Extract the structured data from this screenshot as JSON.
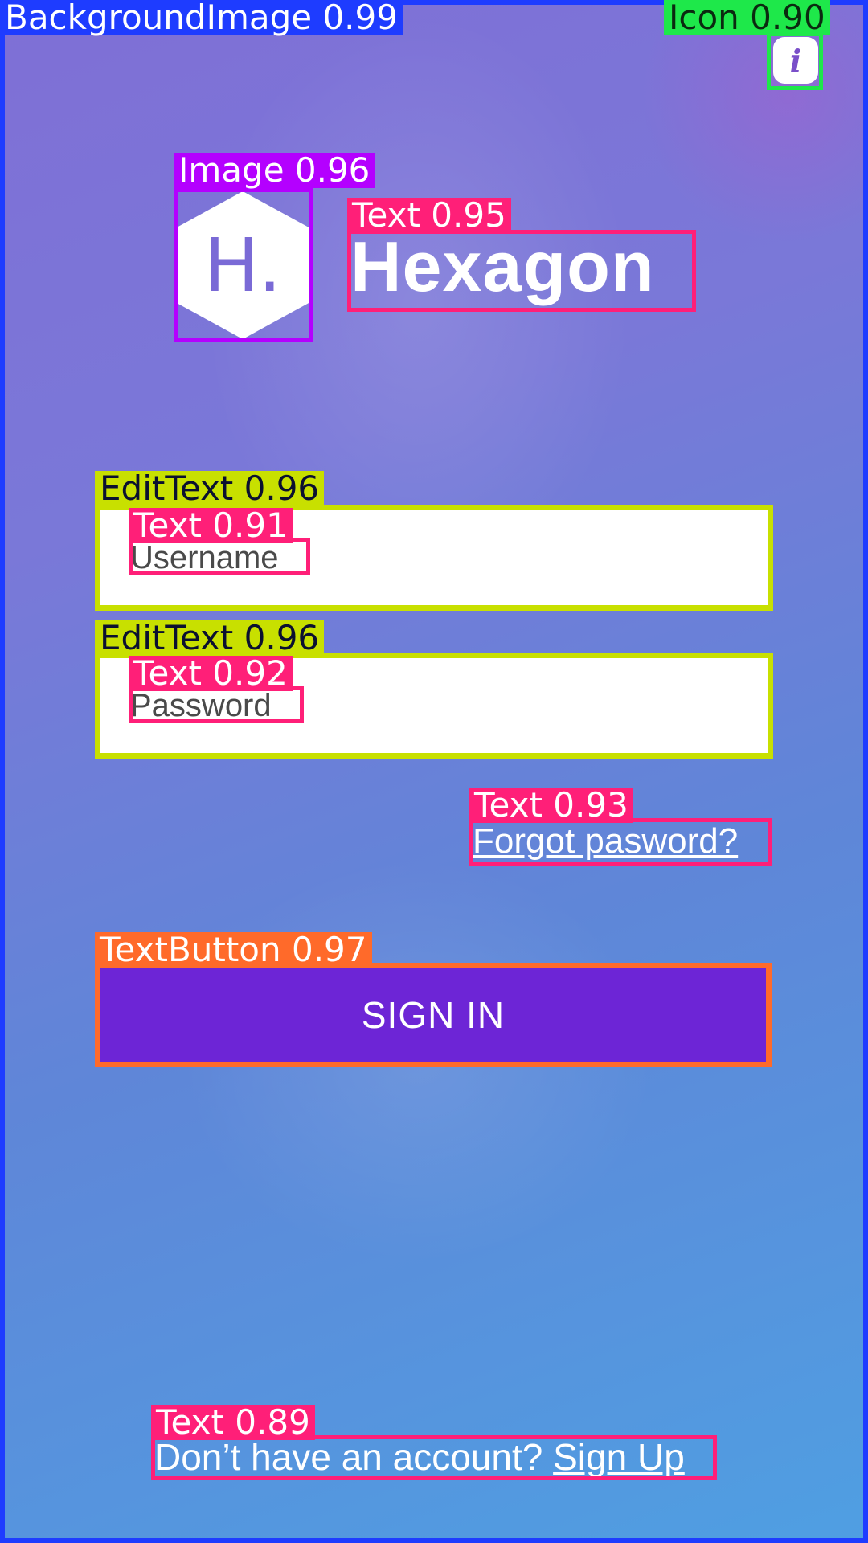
{
  "app": {
    "title": "Hexagon",
    "logo_letter": "H."
  },
  "info_icon": {
    "glyph": "i",
    "name": "info-icon"
  },
  "form": {
    "username_placeholder": "Username",
    "password_placeholder": "Password",
    "forgot_label": "Forgot pasword?",
    "signin_label": "SIGN IN"
  },
  "footer": {
    "prompt": "Don’t have an account?",
    "signup_label": "Sign Up"
  },
  "annotations": {
    "background": "BackgroundImage 0.99",
    "icon": "Icon 0.90",
    "image": "Image 0.96",
    "title_text": "Text 0.95",
    "edit_username": "EditText 0.96",
    "username_text": "Text 0.91",
    "edit_password": "EditText 0.96",
    "password_text": "Text 0.92",
    "forgot_text": "Text 0.93",
    "text_button": "TextButton 0.97",
    "signup_text": "Text 0.89"
  },
  "colors": {
    "accent": "#6d25d6",
    "frame_blue": "#1e3cff",
    "tag_pink": "#ff1f78",
    "tag_lime": "#c8e000",
    "tag_purple": "#b400ff",
    "tag_green": "#1ee84a",
    "tag_orange": "#ff6a2a"
  }
}
